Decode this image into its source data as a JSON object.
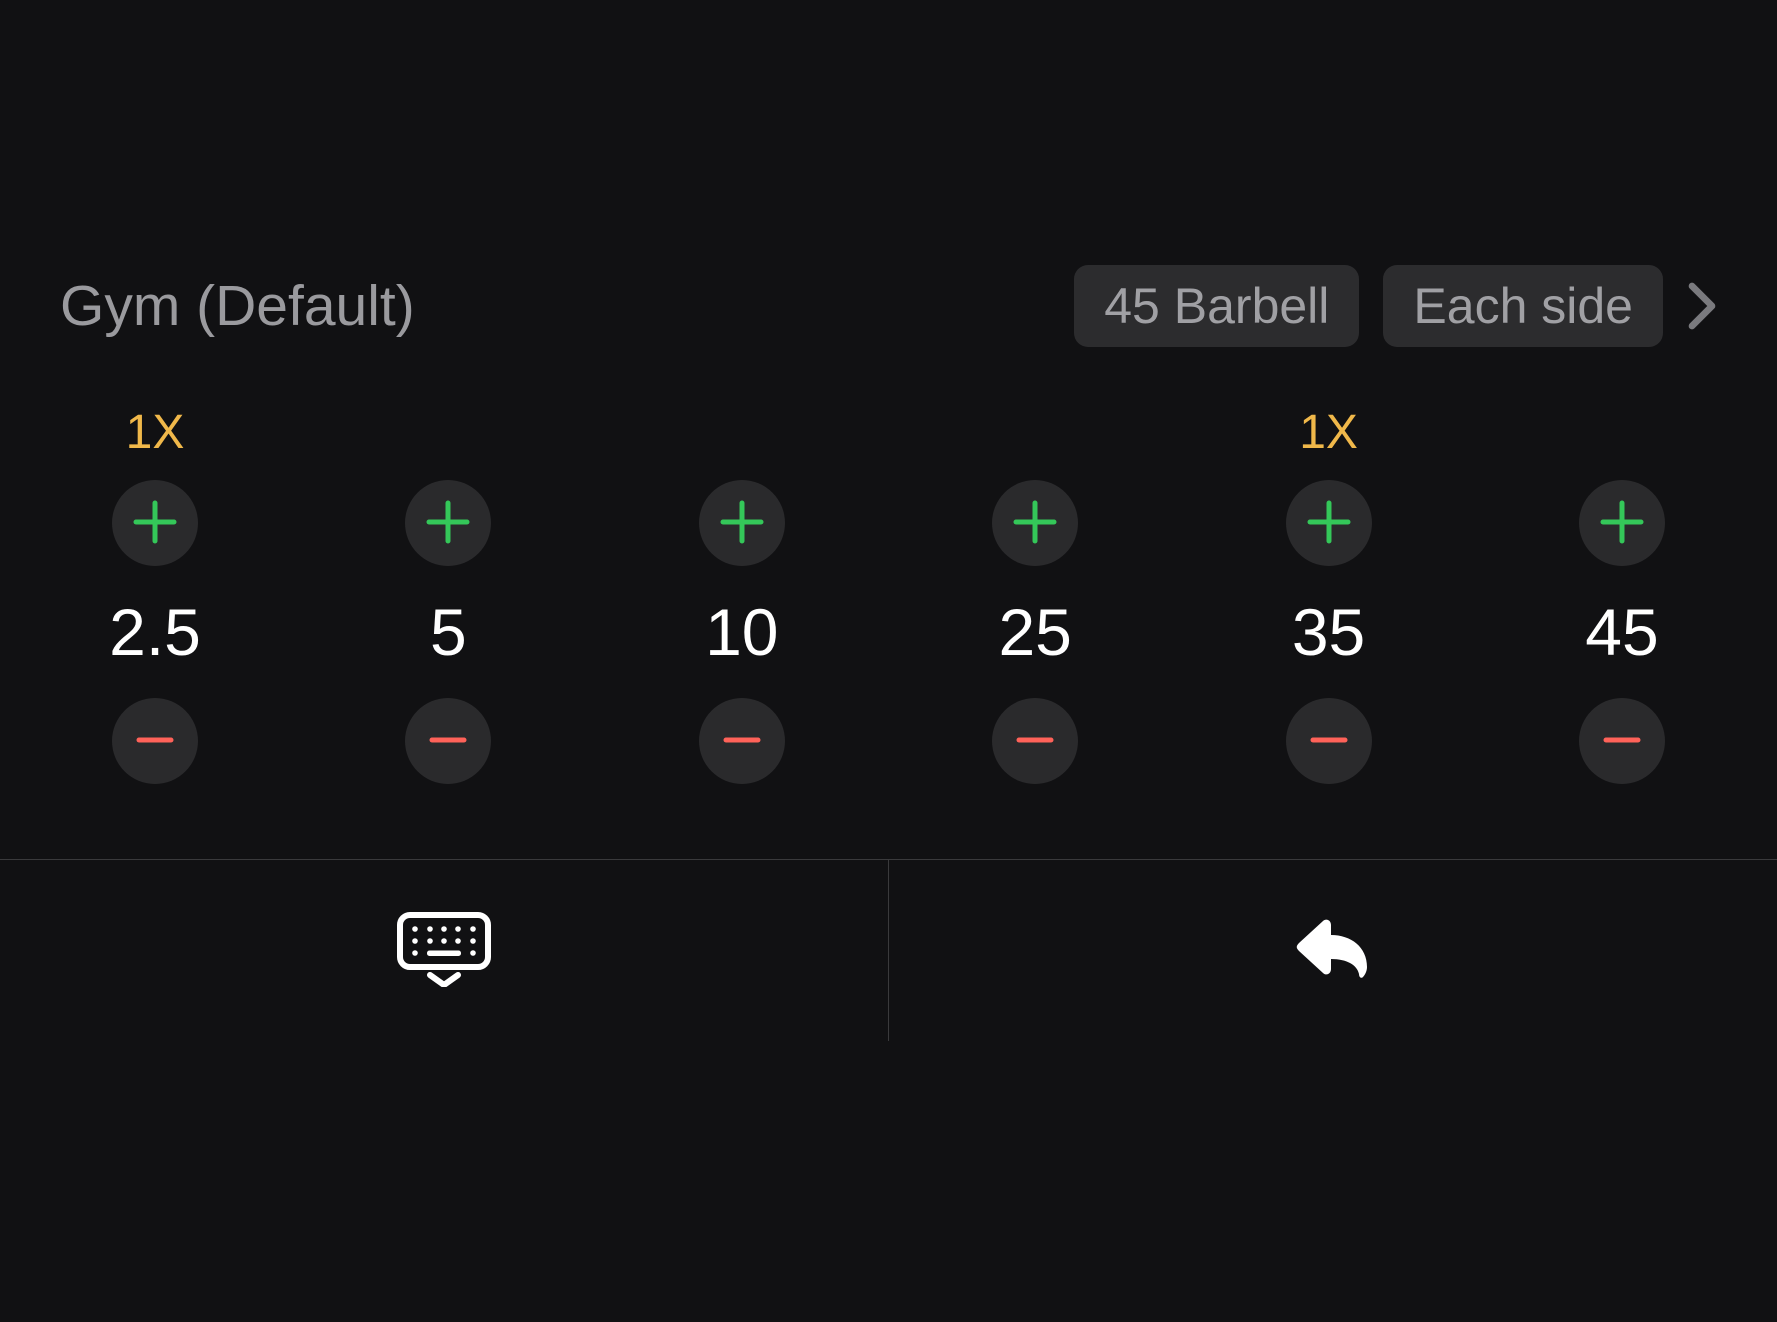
{
  "header": {
    "title": "Gym (Default)",
    "chips": {
      "barbell": "45 Barbell",
      "side": "Each side"
    }
  },
  "plates": [
    {
      "value": "2.5",
      "multiplier": "1X"
    },
    {
      "value": "5",
      "multiplier": ""
    },
    {
      "value": "10",
      "multiplier": ""
    },
    {
      "value": "25",
      "multiplier": ""
    },
    {
      "value": "35",
      "multiplier": "1X"
    },
    {
      "value": "45",
      "multiplier": ""
    }
  ]
}
